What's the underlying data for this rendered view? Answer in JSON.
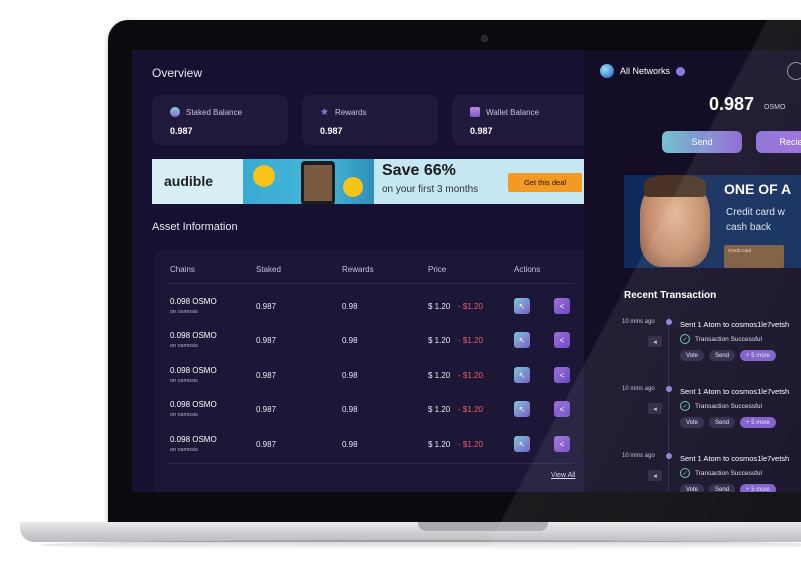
{
  "overview": {
    "title": "Overview",
    "cards": [
      {
        "label": "Staked Balance",
        "value": "0.987",
        "icon": "stack-coins-icon"
      },
      {
        "label": "Rewards",
        "value": "0.987",
        "icon": "star-icon"
      },
      {
        "label": "Wallet Balance",
        "value": "0.987",
        "icon": "wallet-icon"
      }
    ]
  },
  "ad_top": {
    "brand": "audible",
    "headline": "Save 66%",
    "subline": "on your first 3 months",
    "cta": "Get this deal"
  },
  "assets": {
    "title": "Asset Information",
    "columns": [
      "Chains",
      "Staked",
      "Rewards",
      "Price",
      "Actions"
    ],
    "rows": [
      {
        "chain": "0.098 OSMO",
        "sub": "on osmosis",
        "staked": "0.987",
        "rewards": "0.98",
        "price": "$ 1.20",
        "change": "- $1.20"
      },
      {
        "chain": "0.098 OSMO",
        "sub": "on osmosis",
        "staked": "0.987",
        "rewards": "0.98",
        "price": "$ 1.20",
        "change": "- $1.20"
      },
      {
        "chain": "0.098 OSMO",
        "sub": "on osmosis",
        "staked": "0.987",
        "rewards": "0.98",
        "price": "$ 1.20",
        "change": "- $1.20"
      },
      {
        "chain": "0.098 OSMO",
        "sub": "on osmosis",
        "staked": "0.987",
        "rewards": "0.98",
        "price": "$ 1.20",
        "change": "- $1.20"
      },
      {
        "chain": "0.098 OSMO",
        "sub": "on osmosis",
        "staked": "0.987",
        "rewards": "0.98",
        "price": "$ 1.20",
        "change": "- $1.20"
      }
    ],
    "view_all": "View All"
  },
  "wallet": {
    "network": "All Networks",
    "balance": "0.987",
    "unit": "OSMO",
    "send": "Send",
    "receive": "Recie"
  },
  "ad_side": {
    "headline": "ONE OF A",
    "line1": "Credit card w",
    "line2": "cash back",
    "card_label": "Credit Card"
  },
  "recent": {
    "title": "Recent Transaction",
    "items": [
      {
        "time": "10 mins ago",
        "text": "Sent 1 Atom to cosmos1le7vetsh",
        "status": "Transaction Successful",
        "tags": [
          "Vote",
          "Send",
          "+ 5 more"
        ]
      },
      {
        "time": "10 mins ago",
        "text": "Sent 1 Atom to cosmos1le7vetsh",
        "status": "Transaction Successful",
        "tags": [
          "Vote",
          "Send",
          "+ 5 more"
        ]
      },
      {
        "time": "10 mins ago",
        "text": "Sent 1 Atom to cosmos1le7vetsh",
        "status": "Transaction Successful",
        "tags": [
          "Vote",
          "Send",
          "+ 5 more"
        ]
      }
    ]
  },
  "colors": {
    "accent_teal": "#76c3cf",
    "accent_purple": "#8b63d1",
    "negative": "#ef5f6b",
    "panel": "#171131"
  }
}
